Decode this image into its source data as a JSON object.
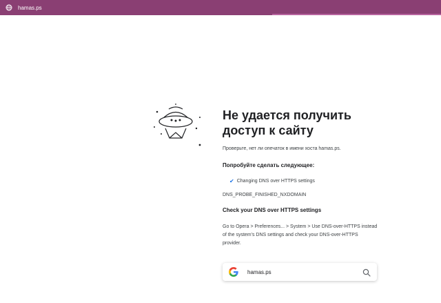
{
  "browser": {
    "tab_url": "hamas.ps",
    "accent_color": "#8a3f73"
  },
  "error": {
    "title": "Не удается получить доступ к сайту",
    "hint": "Проверьте, нет ли опечаток в имени хоста hamas.ps.",
    "try_heading": "Попробуйте сделать следующее:",
    "suggestion": "Changing DNS over HTTPS settings",
    "error_code": "DNS_PROBE_FINISHED_NXDOMAIN",
    "dns_heading": "Check your DNS over HTTPS settings",
    "dns_text": "Go to Opera > Preferences... > System > Use DNS-over-HTTPS instead of the system's DNS settings and check your DNS-over-HTTPS provider."
  },
  "search": {
    "value": "hamas.ps",
    "icons": [
      "google-icon",
      "search-icon"
    ]
  }
}
